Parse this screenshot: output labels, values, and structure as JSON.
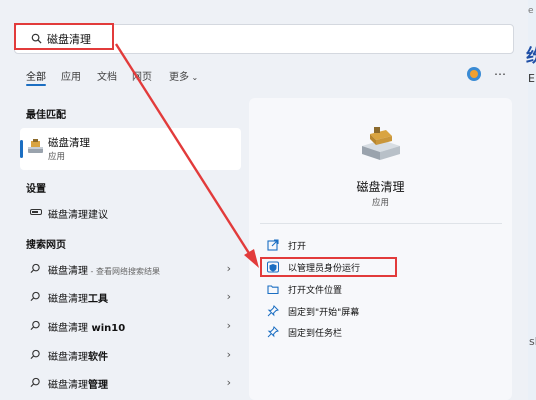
{
  "search": {
    "query": "磁盘清理"
  },
  "tabs": [
    {
      "label": "全部"
    },
    {
      "label": "应用"
    },
    {
      "label": "文档"
    },
    {
      "label": "网页"
    },
    {
      "label": "更多"
    }
  ],
  "best_match": {
    "heading": "最佳匹配",
    "title": "磁盘清理",
    "subtitle": "应用"
  },
  "settings": {
    "heading": "设置",
    "item": {
      "bold": "磁盘清理",
      "rest": "建议"
    }
  },
  "web": {
    "heading": "搜索网页",
    "items": [
      {
        "main": "磁盘清理",
        "extra": " - 查看网络搜索结果"
      },
      {
        "main": "磁盘清理",
        "extra": "工具"
      },
      {
        "main": "磁盘清理",
        "extra": " win10"
      },
      {
        "main": "磁盘清理",
        "extra": "软件"
      },
      {
        "main": "磁盘清理",
        "extra": "管理"
      }
    ]
  },
  "detail": {
    "title": "磁盘清理",
    "subtitle": "应用",
    "actions": [
      {
        "label": "打开",
        "icon": "open-icon"
      },
      {
        "label": "以管理员身份运行",
        "icon": "shield-icon"
      },
      {
        "label": "打开文件位置",
        "icon": "folder-icon"
      },
      {
        "label": "固定到\"开始\"屏幕",
        "icon": "pin-icon"
      },
      {
        "label": "固定到任务栏",
        "icon": "pin-icon"
      }
    ]
  },
  "background": {
    "t1": "e",
    "t2": "纷",
    "t3": "E",
    "t4": "sk"
  },
  "colors": {
    "accent": "#1b6ec2",
    "highlight": "#e23b3b"
  }
}
